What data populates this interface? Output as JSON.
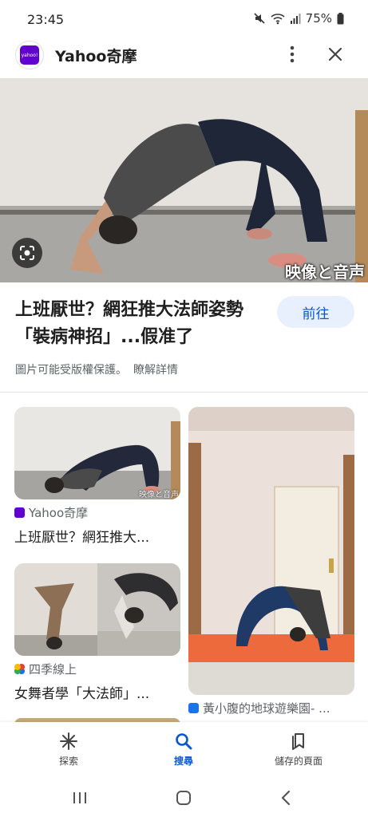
{
  "status_bar": {
    "time": "23:45",
    "battery": "75%",
    "icons": [
      "mute-icon",
      "wifi-icon",
      "signal-icon",
      "battery-icon"
    ]
  },
  "header": {
    "logo_text": "yahoo!",
    "title": "Yahoo奇摩",
    "icons": [
      "more-vertical-icon",
      "close-icon"
    ]
  },
  "hero": {
    "watermark": "映像と音声",
    "lens_icon": "lens-icon"
  },
  "result": {
    "title": "上班厭世？網狂推大法師姿勢「裝病神招」...假准了",
    "visit_label": "前往",
    "copyright_note": "圖片可能受版權保護。",
    "learn_more": "瞭解詳情"
  },
  "grid": {
    "cards": [
      {
        "source": "Yahoo奇摩",
        "title": "上班厭世？網狂推大...",
        "watermark": "映像と音声",
        "source_color": "#6001d2"
      },
      {
        "source": "四季線上",
        "title": "女舞者學「大法師」...",
        "source_color": "#e94235"
      },
      {
        "source": "黃小腹的地球遊樂園- ...",
        "title": "",
        "source_color": "#1a73e8"
      }
    ]
  },
  "bottom_nav": {
    "items": [
      {
        "label": "探索",
        "icon": "asterisk-icon"
      },
      {
        "label": "搜尋",
        "icon": "search-icon"
      },
      {
        "label": "儲存的頁面",
        "icon": "bookmarks-icon"
      }
    ],
    "active": "搜尋"
  },
  "colors": {
    "accent": "#0b57d0",
    "visit_button_bg": "#e8f0fe",
    "yahoo_purple": "#6001d2"
  }
}
